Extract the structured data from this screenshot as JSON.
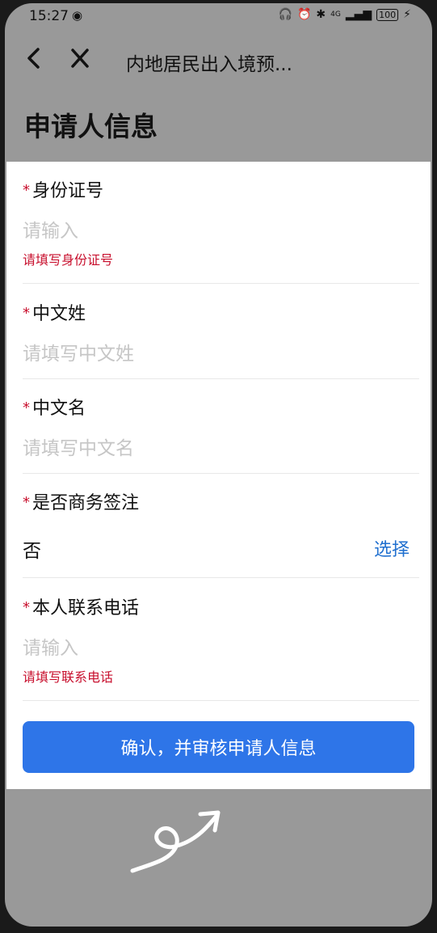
{
  "status_bar": {
    "time": "15:27",
    "battery": "100",
    "network": "4G"
  },
  "navbar": {
    "title": "内地居民出入境预..."
  },
  "page": {
    "title": "申请人信息"
  },
  "form": {
    "required_mark": "*",
    "id_number": {
      "label": "身份证号",
      "placeholder": "请输入",
      "error": "请填写身份证号"
    },
    "surname": {
      "label": "中文姓",
      "placeholder": "请填写中文姓"
    },
    "given_name": {
      "label": "中文名",
      "placeholder": "请填写中文名"
    },
    "business_endorsement": {
      "label": "是否商务签注",
      "value": "否",
      "action": "选择"
    },
    "phone": {
      "label": "本人联系电话",
      "placeholder": "请输入",
      "error": "请填写联系电话"
    },
    "confirm_label": "确认，并审核申请人信息"
  },
  "colors": {
    "accent": "#2e75e8",
    "error": "#c8102e",
    "link": "#1f6fcf",
    "overlay": "#999999"
  }
}
